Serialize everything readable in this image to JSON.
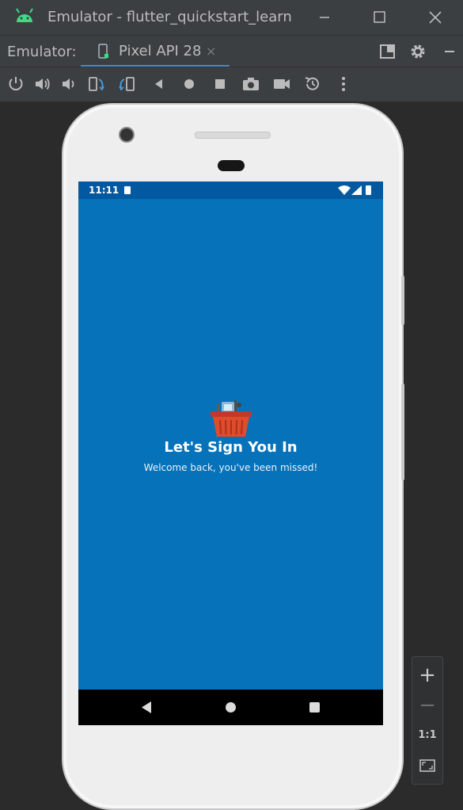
{
  "window": {
    "title": "Emulator - flutter_quickstart_learn",
    "controls": [
      "minimize-icon",
      "maximize-icon",
      "close-icon"
    ]
  },
  "tabbar": {
    "label": "Emulator:",
    "tab_label": "Pixel API 28",
    "tab_close": "×",
    "right_icons": [
      "layout-icon",
      "gear-icon",
      "minimize-panel-icon"
    ]
  },
  "toolbar": {
    "icons": [
      "power-icon",
      "volume-up-icon",
      "volume-down-icon",
      "rotate-left-icon",
      "rotate-right-icon",
      "back-icon",
      "home-icon",
      "overview-icon",
      "screenshot-icon",
      "screen-record-icon",
      "snapshot-icon",
      "more-icon"
    ]
  },
  "device": {
    "status_time": "11:11",
    "headline": "Let's Sign You In",
    "subline": "Welcome back, you've been missed!"
  },
  "zoom": {
    "plus": "+",
    "minus": "−",
    "one_to_one": "1:1"
  },
  "colors": {
    "accent": "#4a88c7",
    "screen_bg": "#0672b9",
    "status_bar": "#0359a0"
  }
}
